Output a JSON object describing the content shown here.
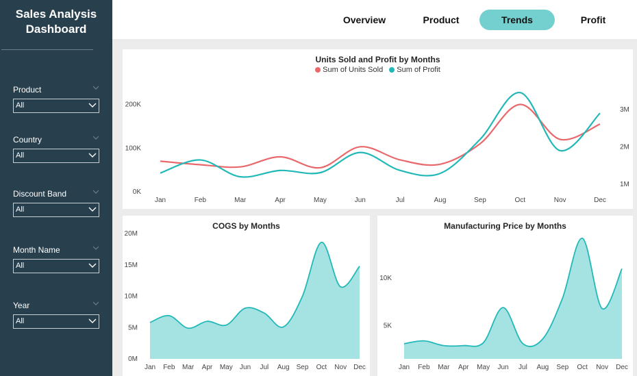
{
  "sidebar": {
    "title_line1": "Sales Analysis",
    "title_line2": "Dashboard",
    "slicers": [
      {
        "label": "Product",
        "value": "All"
      },
      {
        "label": "Country",
        "value": "All"
      },
      {
        "label": "Discount Band",
        "value": "All"
      },
      {
        "label": "Month Name",
        "value": "All"
      },
      {
        "label": "Year",
        "value": "All"
      }
    ]
  },
  "nav": {
    "tabs": [
      {
        "label": "Overview",
        "active": false
      },
      {
        "label": "Product",
        "active": false
      },
      {
        "label": "Trends",
        "active": true
      },
      {
        "label": "Profit",
        "active": false
      }
    ],
    "active_color": "#74cfcf"
  },
  "chart_data": [
    {
      "type": "line",
      "title": "Units Sold and Profit by Months",
      "categories": [
        "Jan",
        "Feb",
        "Mar",
        "Apr",
        "May",
        "Jun",
        "Jul",
        "Aug",
        "Sep",
        "Oct",
        "Nov",
        "Dec"
      ],
      "series": [
        {
          "name": "Sum of Units Sold",
          "axis": "left",
          "color": "#e8686b",
          "values": [
            70000,
            62000,
            57000,
            80000,
            55000,
            103000,
            73000,
            63000,
            110000,
            200000,
            120000,
            155000
          ]
        },
        {
          "name": "Sum of Profit",
          "axis": "right",
          "color": "#22b8b8",
          "values": [
            1300000,
            1650000,
            1200000,
            1370000,
            1310000,
            1850000,
            1370000,
            1290000,
            2200000,
            3450000,
            1900000,
            2900000
          ]
        }
      ],
      "y_left": {
        "ticks": [
          0,
          100000,
          200000
        ],
        "tick_labels": [
          "0K",
          "100K",
          "200K"
        ],
        "range": [
          0,
          240000
        ]
      },
      "y_right": {
        "ticks": [
          1000000,
          2000000,
          3000000
        ],
        "tick_labels": [
          "1M",
          "2M",
          "3M"
        ],
        "range": [
          800000,
          3600000
        ]
      },
      "legend": "top-center",
      "grid": false
    },
    {
      "type": "area",
      "title": "COGS by Months",
      "categories": [
        "Jan",
        "Feb",
        "Mar",
        "Apr",
        "May",
        "Jun",
        "Jul",
        "Aug",
        "Sep",
        "Oct",
        "Nov",
        "Dec"
      ],
      "series": [
        {
          "name": "",
          "color": "#22b8b8",
          "fill": "#a5e2e2",
          "values": [
            5800000,
            6900000,
            4900000,
            6000000,
            5400000,
            8100000,
            7300000,
            5100000,
            10000000,
            18600000,
            11500000,
            14800000
          ]
        }
      ],
      "y": {
        "ticks": [
          0,
          5000000,
          10000000,
          15000000,
          20000000
        ],
        "tick_labels": [
          "0M",
          "5M",
          "10M",
          "15M",
          "20M"
        ],
        "range": [
          0,
          20000000
        ]
      },
      "grid": false
    },
    {
      "type": "area",
      "title": "Manufacturing Price by Months",
      "categories": [
        "Jan",
        "Feb",
        "Mar",
        "Apr",
        "May",
        "Jun",
        "Jul",
        "Aug",
        "Sep",
        "Oct",
        "Nov",
        "Dec"
      ],
      "series": [
        {
          "name": "",
          "color": "#22b8b8",
          "fill": "#a5e2e2",
          "values": [
            3100,
            3400,
            2900,
            2900,
            3200,
            6900,
            3100,
            3600,
            7900,
            14200,
            6800,
            11000
          ]
        }
      ],
      "y": {
        "ticks": [
          5000,
          10000
        ],
        "tick_labels": [
          "5K",
          "10K"
        ],
        "range": [
          1500,
          14700
        ]
      },
      "grid": false
    }
  ]
}
